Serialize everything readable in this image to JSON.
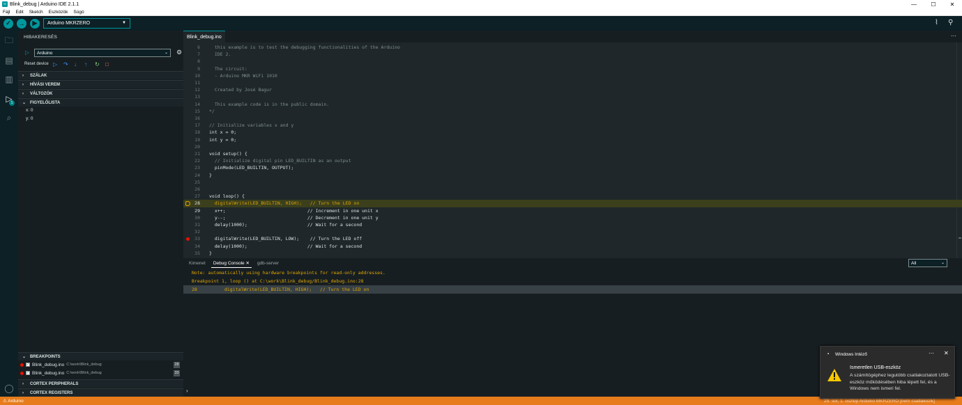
{
  "window": {
    "title": "Blink_debug | Arduino IDE 2.1.1"
  },
  "menu": [
    "Fájl",
    "Edit",
    "Sketch",
    "Eszközök",
    "Súgó"
  ],
  "toolbar": {
    "board": "Arduino MKRZERO"
  },
  "debug": {
    "header": "HIBAKERESÉS",
    "config": "Arduino",
    "reset": "Reset device",
    "sections": {
      "threads": "SZÁLAK",
      "callstack": "HÍVÁSI VEREM",
      "variables": "VÁLTOZÓK",
      "watch": "FIGYELŐLISTA",
      "breakpoints": "BREAKPOINTS",
      "peripherals": "CORTEX PERIPHERALS",
      "registers": "CORTEX REGISTERS"
    },
    "watch": [
      "x: 0",
      "y: 0"
    ],
    "breakpoints": [
      {
        "name": "Blink_debug.ino",
        "path": "C:\\work\\Blink_debug",
        "line": "28"
      },
      {
        "name": "Blink_debug.ino",
        "path": "C:\\work\\Blink_debug",
        "line": "33"
      }
    ],
    "badge": "1"
  },
  "editor": {
    "tab": "Blink_debug.ino",
    "lines": [
      {
        "n": "6",
        "t": "  this example is to test the debugging functionalities of the Arduino",
        "c": "cm"
      },
      {
        "n": "7",
        "t": "  IDE 2.",
        "c": "cm"
      },
      {
        "n": "8",
        "t": "",
        "c": "cm"
      },
      {
        "n": "9",
        "t": "  The circuit:",
        "c": "cm"
      },
      {
        "n": "10",
        "t": "  - Arduino MKR WiFi 1010",
        "c": "cm"
      },
      {
        "n": "11",
        "t": "",
        "c": "cm"
      },
      {
        "n": "12",
        "t": "  Created by José Bagur",
        "c": "cm"
      },
      {
        "n": "13",
        "t": "",
        "c": "cm"
      },
      {
        "n": "14",
        "t": "  This example code is in the public domain.",
        "c": "cm"
      },
      {
        "n": "15",
        "t": "*/",
        "c": "cm"
      },
      {
        "n": "16",
        "t": "",
        "c": ""
      },
      {
        "n": "17",
        "t": "// Initialize variables x and y",
        "c": "cm"
      },
      {
        "n": "18",
        "t": "int x = 0;",
        "c": ""
      },
      {
        "n": "19",
        "t": "int y = 0;",
        "c": ""
      },
      {
        "n": "20",
        "t": "",
        "c": ""
      },
      {
        "n": "21",
        "t": "void setup() {",
        "c": ""
      },
      {
        "n": "22",
        "t": "  // Initialize digital pin LED_BUILTIN as an output",
        "c": "cm"
      },
      {
        "n": "23",
        "t": "  pinMode(LED_BUILTIN, OUTPUT);",
        "c": ""
      },
      {
        "n": "24",
        "t": "}",
        "c": ""
      },
      {
        "n": "25",
        "t": "",
        "c": ""
      },
      {
        "n": "26",
        "t": "",
        "c": ""
      },
      {
        "n": "27",
        "t": "void loop() {",
        "c": ""
      },
      {
        "n": "28",
        "t": "  digitalWrite(LED_BUILTIN, HIGH);   // Turn the LED on",
        "c": "cur"
      },
      {
        "n": "29",
        "t": "  x++;                              // Increment in one unit x",
        "c": ""
      },
      {
        "n": "30",
        "t": "  y--;                              // Decrement in one unit y",
        "c": ""
      },
      {
        "n": "31",
        "t": "  delay(1000);                      // Wait for a second",
        "c": ""
      },
      {
        "n": "32",
        "t": "",
        "c": ""
      },
      {
        "n": "33",
        "t": "  digitalWrite(LED_BUILTIN, LOW);    // Turn the LED off",
        "c": "bp"
      },
      {
        "n": "34",
        "t": "  delay(1000);                      // Wait for a second",
        "c": ""
      },
      {
        "n": "35",
        "t": "}",
        "c": ""
      }
    ]
  },
  "panel": {
    "tabs": [
      "Kimenet",
      "Debug Console",
      "gdb-server"
    ],
    "filter": "All",
    "lines": [
      {
        "t": "Note: automatically using hardware breakpoints for read-only addresses.",
        "color": "#e0a600"
      },
      {
        "t": "Breakpoint 1, loop () at C:\\work\\Blink_debug/Blink_debug.ino:28",
        "color": "#e0a600"
      },
      {
        "t": "28\t    digitalWrite(LED_BUILTIN, HIGH);   // Turn the LED on",
        "color": "#e0a600"
      }
    ]
  },
  "status": {
    "left": "Arduino",
    "right": "29. sor, 1. oszlop    Arduino MKRZERO [nem csatlakozik]"
  },
  "toast": {
    "app": "Windows Intéző",
    "title": "Ismeretlen USB-eszköz",
    "body": "A számítógéphez legutóbb csatlakoztatott USB-eszköz működésében hiba lépett fel, és a Windows nem ismeri fel."
  }
}
